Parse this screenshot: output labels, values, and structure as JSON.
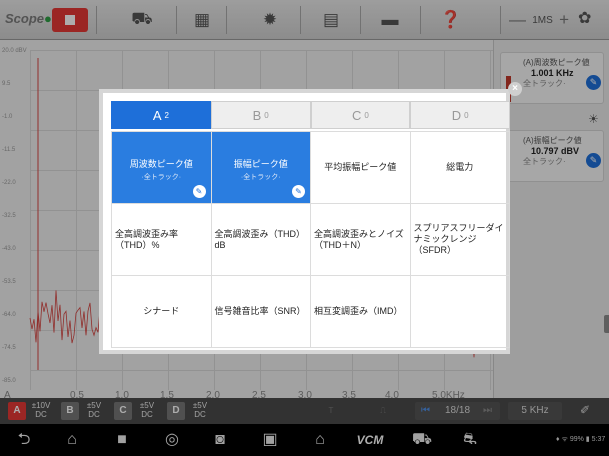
{
  "app": {
    "logo_a": "Scope",
    "logo_b": "●"
  },
  "toolbar": {
    "icons": [
      "stop-icon",
      "car-icon",
      "chart-window-icon",
      "gear-icon",
      "document-icon",
      "folder-icon",
      "help-icon"
    ],
    "timebase_minus": "—",
    "timebase_value": "1MS",
    "timebase_plus": "+",
    "settings_icon": "✿"
  },
  "scope": {
    "y_labels": [
      "20.0 dBV",
      "9.5",
      "-1.0",
      "-11.5",
      "-22.0",
      "-32.5",
      "-43.0",
      "-53.5",
      "-64.0",
      "-74.5",
      "-85.0"
    ],
    "x_labels": [
      "A",
      "0.5",
      "1.0",
      "1.5",
      "2.0",
      "2.5",
      "3.0",
      "3.5",
      "4.0",
      "5.0KHz"
    ]
  },
  "side_panel": {
    "m1_title": "(A)周波数ピーク値",
    "m1_value": "1.001 KHz",
    "m1_sub": "全トラック·",
    "m2_title": "(A)振幅ピーク値",
    "m2_value": "10.797 dBV",
    "m2_sub": "全トラック·"
  },
  "channels": [
    {
      "label": "A",
      "sub": "x1",
      "volt": "±10V",
      "coupling": "DC",
      "color": "#e53935"
    },
    {
      "label": "B",
      "sub": "x1",
      "volt": "±5V",
      "coupling": "DC",
      "color": "#777777"
    },
    {
      "label": "C",
      "sub": "x1",
      "volt": "±5V",
      "coupling": "DC",
      "color": "#777777"
    },
    {
      "label": "D",
      "sub": "x1",
      "volt": "±5V",
      "coupling": "DC",
      "color": "#777777"
    }
  ],
  "bottom": {
    "page": "18/18",
    "freq": "5 KHz",
    "trigger_t": "T",
    "trigger_edge": "⎍"
  },
  "statusbar": {
    "text": "♦ ᯤ 99% ▮ 5:37"
  },
  "dialog": {
    "tabs": [
      {
        "label": "A",
        "count": "2"
      },
      {
        "label": "B",
        "count": "0"
      },
      {
        "label": "C",
        "count": "0"
      },
      {
        "label": "D",
        "count": "0"
      }
    ],
    "cells": [
      {
        "text": "周波数ピーク値",
        "sub": "·全トラック·"
      },
      {
        "text": "振幅ピーク値",
        "sub": "·全トラック·"
      },
      {
        "text": "平均振幅ピーク値"
      },
      {
        "text": "総電力"
      },
      {
        "text": "全高調波歪み率（THD）%"
      },
      {
        "text": "全高調波歪み（THD）dB"
      },
      {
        "text": "全高調波歪みとノイズ（THD＋N）"
      },
      {
        "text": "スプリアスフリーダイナミックレンジ（SFDR）"
      },
      {
        "text": "シナード"
      },
      {
        "text": "信号雑音比率（SNR）"
      },
      {
        "text": "相互変調歪み（IMD）"
      },
      {
        "text": ""
      }
    ]
  }
}
